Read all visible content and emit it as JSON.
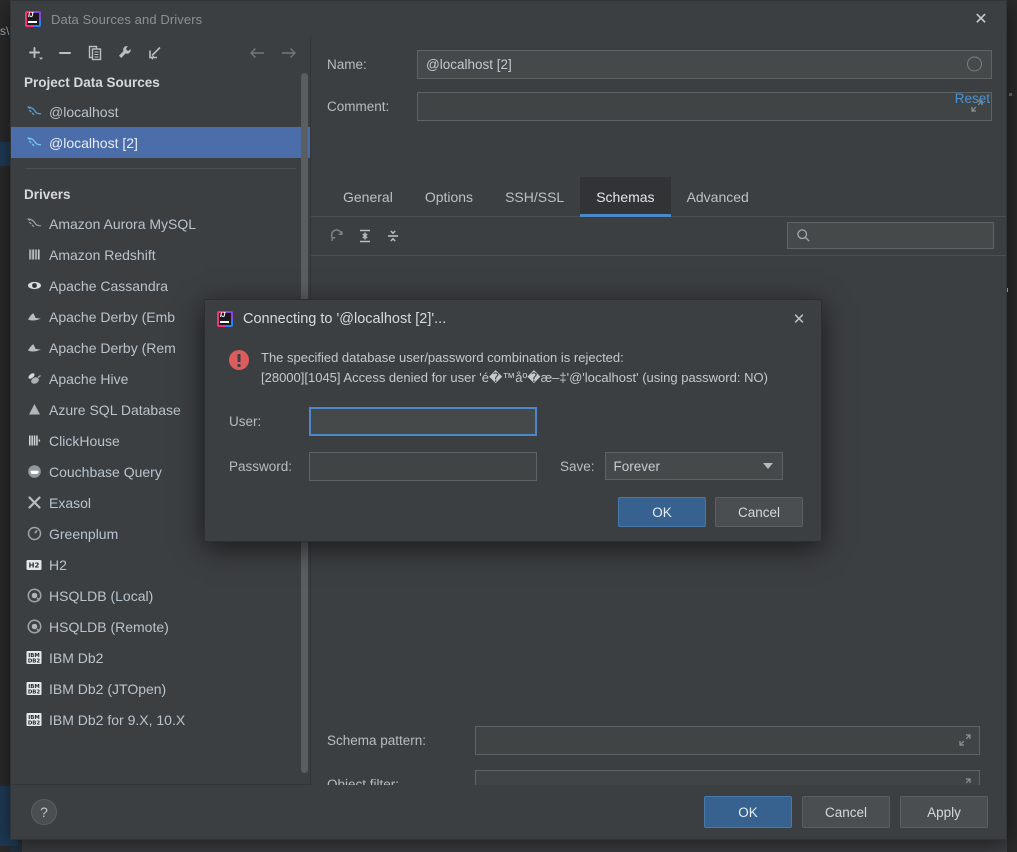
{
  "backdrop": {
    "corner_text": "s\\"
  },
  "window": {
    "title": "Data Sources and Drivers",
    "app_icon": "intellij-idea-icon",
    "close_icon": "close-icon"
  },
  "left_pane": {
    "toolbar": [
      {
        "name": "add-button",
        "icon": "plus-dropdown-icon"
      },
      {
        "name": "remove-button",
        "icon": "minus-icon"
      },
      {
        "name": "duplicate-button",
        "icon": "copy-icon"
      },
      {
        "name": "properties-button",
        "icon": "wrench-icon"
      },
      {
        "name": "import-button",
        "icon": "import-arrow-icon"
      }
    ],
    "nav": [
      {
        "name": "back-button",
        "icon": "arrow-left-icon"
      },
      {
        "name": "forward-button",
        "icon": "arrow-right-icon"
      }
    ],
    "groups": [
      {
        "label": "Project Data Sources",
        "items": [
          {
            "label": "@localhost",
            "icon": "mysql-dolphin-icon",
            "selected": false
          },
          {
            "label": "@localhost [2]",
            "icon": "mysql-dolphin-icon",
            "selected": true
          }
        ]
      },
      {
        "label": "Drivers",
        "items": [
          {
            "label": "Amazon Aurora MySQL",
            "icon": "mysql-dolphin-icon"
          },
          {
            "label": "Amazon Redshift",
            "icon": "redshift-icon"
          },
          {
            "label": "Apache Cassandra",
            "icon": "cassandra-eye-icon"
          },
          {
            "label": "Apache Derby (Emb",
            "icon": "derby-hat-icon"
          },
          {
            "label": "Apache Derby (Rem",
            "icon": "derby-hat-icon"
          },
          {
            "label": "Apache Hive",
            "icon": "hive-bee-icon"
          },
          {
            "label": "Azure SQL Database",
            "icon": "azure-icon"
          },
          {
            "label": "ClickHouse",
            "icon": "clickhouse-icon"
          },
          {
            "label": "Couchbase Query",
            "icon": "couchbase-icon"
          },
          {
            "label": "Exasol",
            "icon": "exasol-x-icon"
          },
          {
            "label": "Greenplum",
            "icon": "greenplum-icon"
          },
          {
            "label": "H2",
            "icon": "h2-icon"
          },
          {
            "label": "HSQLDB (Local)",
            "icon": "hsqldb-icon"
          },
          {
            "label": "HSQLDB (Remote)",
            "icon": "hsqldb-icon"
          },
          {
            "label": "IBM Db2",
            "icon": "ibm-db2-icon"
          },
          {
            "label": "IBM Db2 (JTOpen)",
            "icon": "ibm-db2-icon"
          },
          {
            "label": "IBM Db2 for 9.X, 10.X",
            "icon": "ibm-db2-icon"
          }
        ]
      }
    ]
  },
  "right_pane": {
    "name_label": "Name:",
    "name_value": "@localhost [2]",
    "comment_label": "Comment:",
    "comment_value": "",
    "reset_label": "Reset",
    "tabs": [
      {
        "label": "General",
        "active": false
      },
      {
        "label": "Options",
        "active": false
      },
      {
        "label": "SSH/SSL",
        "active": false
      },
      {
        "label": "Schemas",
        "active": true
      },
      {
        "label": "Advanced",
        "active": false
      }
    ],
    "schemas_toolbar": [
      {
        "name": "refresh-button",
        "icon": "refresh-icon"
      },
      {
        "name": "expand-all-button",
        "icon": "expand-all-icon"
      },
      {
        "name": "collapse-all-button",
        "icon": "collapse-all-icon"
      }
    ],
    "search": {
      "placeholder": "",
      "value": "",
      "icon": "search-icon"
    },
    "schema_pattern_label": "Schema pattern:",
    "schema_pattern_value": "",
    "object_filter_label": "Object filter:",
    "object_filter_value": ""
  },
  "footer": {
    "help_label": "?",
    "ok_label": "OK",
    "cancel_label": "Cancel",
    "apply_label": "Apply"
  },
  "modal": {
    "title": "Connecting to '@localhost [2]'...",
    "app_icon": "intellij-idea-icon",
    "close_icon": "close-icon",
    "error_icon": "error-circle-icon",
    "error_line1": "The specified database user/password combination is rejected:",
    "error_line2": "[28000][1045] Access denied for user 'é�™åº�æ–‡'@'localhost' (using password: NO)",
    "user_label": "User:",
    "user_value": "",
    "password_label": "Password:",
    "password_value": "",
    "save_label": "Save:",
    "save_value": "Forever",
    "ok_label": "OK",
    "cancel_label": "Cancel"
  },
  "colors": {
    "accent_blue": "#4b6eab",
    "primary_button": "#37618f",
    "tab_underline": "#4a88c7",
    "link": "#4a93d4",
    "error_red": "#db5c5c",
    "panel_bg": "#3c3f41",
    "field_bg": "#45494a"
  }
}
